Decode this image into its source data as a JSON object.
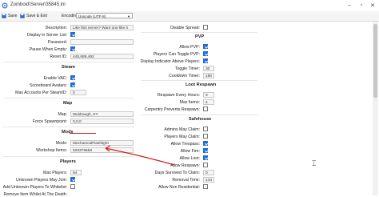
{
  "window": {
    "title": "Zomboid\\Server\\35845.ini"
  },
  "toolbar": {
    "save": "Save",
    "save_exit": "Save & Exit",
    "encoding_label": "Encoding:",
    "encoding_value": "Unicode (UTF-8)"
  },
  "left": {
    "description": {
      "label": "Description:",
      "value": "Like this server? Want one like it"
    },
    "display_in_list": {
      "label": "Display in Server List:"
    },
    "password": {
      "label": "Password:",
      "value": ""
    },
    "pause_when_empty": {
      "label": "Pause When Empty:"
    },
    "reset_id": {
      "label": "Reset ID:",
      "value": "445,689,492"
    },
    "steam_title": "Steam",
    "enable_vac": {
      "label": "Enable VAC:"
    },
    "scoreboard_avatars": {
      "label": "Scoreboard Avatars:"
    },
    "max_accounts": {
      "label": "Max Accounts Per SteamID:",
      "value": "0"
    },
    "map_title": "Map",
    "map": {
      "label": "Map:",
      "value": "Muldraugh, KY"
    },
    "force_spawn": {
      "label": "Force Spawnpoint:",
      "value": "0,0,0"
    },
    "mods_title": "Mods",
    "mods": {
      "label": "Mods:",
      "value": "MechanicalFlashlight"
    },
    "workshop_items": {
      "label": "Workshop Items:",
      "value": "525379658"
    },
    "players_title": "Players",
    "max_players": {
      "label": "Max Players:",
      "value": "64"
    },
    "unknown_may_join": {
      "label": "Unknown Players May Join:"
    },
    "add_unknown": {
      "label": "Add Unknown Players To Whitelist:"
    },
    "remove_item": {
      "label": "Remove Item Whilst At The Death:"
    }
  },
  "right": {
    "disable_spread": {
      "label": "Disable Spread:"
    },
    "pvp_title": "PVP",
    "allow_pvp": {
      "label": "Allow PVP:"
    },
    "players_toggle_pvp": {
      "label": "Players Can Toggle PVP:"
    },
    "display_indicator": {
      "label": "Display Indicator Above Players:"
    },
    "toggle_timer": {
      "label": "Toggle Timer:",
      "value": "30"
    },
    "cooldown_timer": {
      "label": "Cooldown Timer:",
      "value": "180"
    },
    "loot_title": "Loot Respawn",
    "respawn_every": {
      "label": "Respawn Every Hours:",
      "value": "0"
    },
    "max_items": {
      "label": "Max Items:",
      "value": "4"
    },
    "carpentry_prevents": {
      "label": "Carpentry Prevents Respawn:"
    },
    "safehouse_title": "Safehouse",
    "admins_claim": {
      "label": "Admins May Claim:"
    },
    "players_claim": {
      "label": "Players May Claim:"
    },
    "allow_trespass": {
      "label": "Allow Trespass:"
    },
    "allow_fire": {
      "label": "Allow Fire:"
    },
    "allow_loot": {
      "label": "Allow Loot:"
    },
    "allow_respawn": {
      "label": "Allow Respawn:"
    },
    "days_survived": {
      "label": "Days Survived To Claim:",
      "value": "0"
    },
    "removal_time": {
      "label": "Removal Time:",
      "value": "144"
    },
    "allow_non_residential": {
      "label": "Allow Non Residential:"
    }
  }
}
